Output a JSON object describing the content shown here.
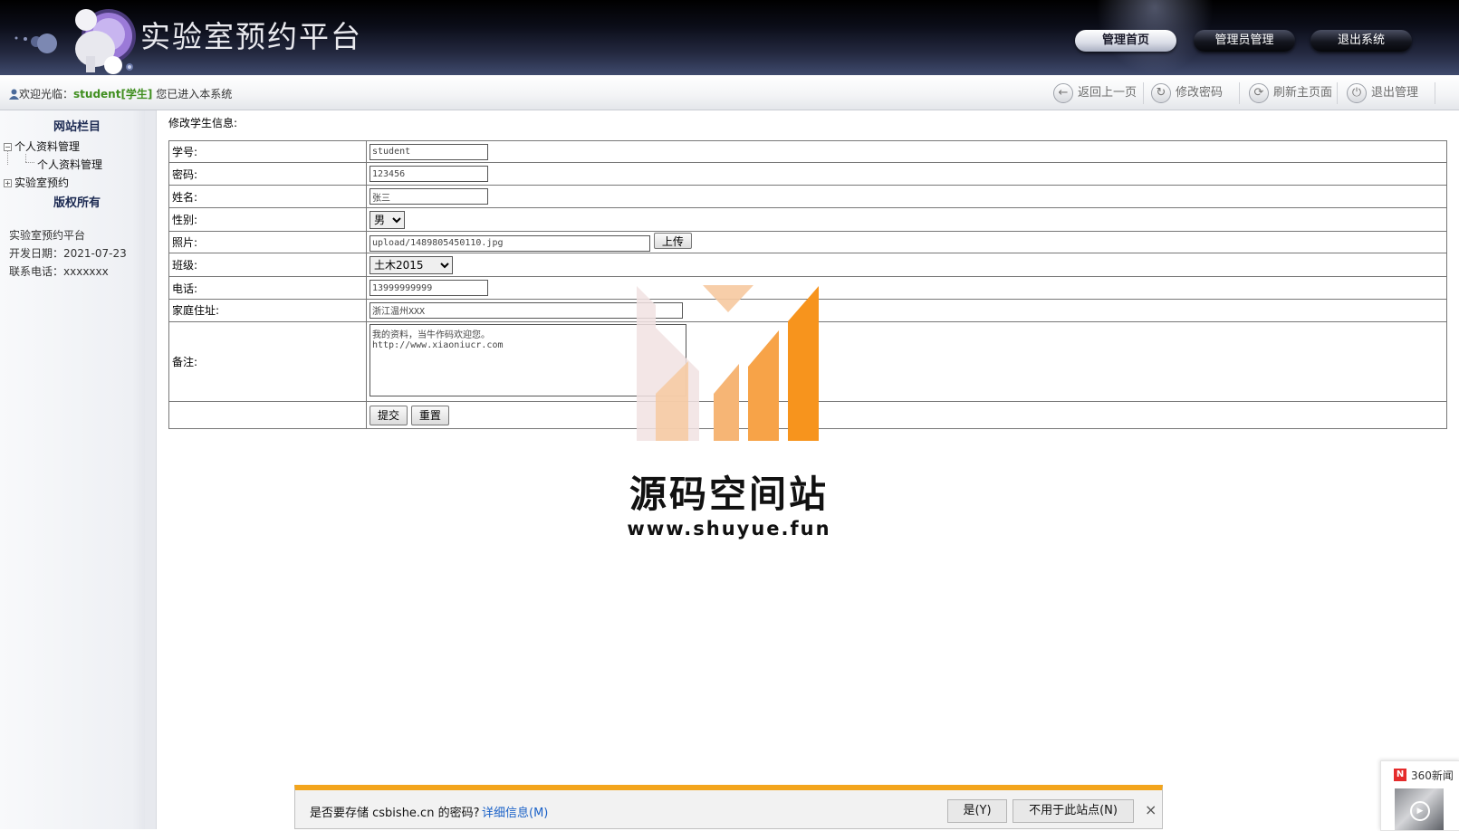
{
  "header": {
    "title": "实验室预约平台",
    "nav": [
      {
        "label": "管理首页",
        "active": true
      },
      {
        "label": "管理员管理",
        "active": false
      },
      {
        "label": "退出系统",
        "active": false
      }
    ]
  },
  "welcome": {
    "prefix": "欢迎光临：",
    "user": "student[学生]",
    "suffix": " 您已进入本系统"
  },
  "toolbar": {
    "back": "返回上一页",
    "change_password": "修改密码",
    "refresh": "刷新主页面",
    "logout": "退出管理"
  },
  "sidebar": {
    "heading": "网站栏目",
    "tree": [
      {
        "label": "个人资料管理",
        "expanded": true,
        "children": [
          "个人资料管理"
        ]
      },
      {
        "label": "实验室预约",
        "expanded": false,
        "children": []
      }
    ],
    "copyright_heading": "版权所有",
    "info": {
      "name": "实验室预约平台",
      "date_label": "开发日期：",
      "date_value": "2021-07-23",
      "phone_label": "联系电话：",
      "phone_value": "xxxxxxx"
    }
  },
  "form": {
    "title": "修改学生信息:",
    "fields": {
      "student_id": {
        "label": "学号:",
        "value": "student"
      },
      "password": {
        "label": "密码:",
        "value": "123456"
      },
      "name": {
        "label": "姓名:",
        "value": "张三"
      },
      "gender": {
        "label": "性别:",
        "value": "男"
      },
      "photo": {
        "label": "照片:",
        "value": "upload/1489805450110.jpg",
        "upload_button": "上传"
      },
      "class": {
        "label": "班级:",
        "value": "土木2015"
      },
      "phone": {
        "label": "电话:",
        "value": "13999999999"
      },
      "address": {
        "label": "家庭住址:",
        "value": "浙江温州XXX"
      },
      "remark": {
        "label": "备注:",
        "value": "我的资料，当牛作码欢迎您。\nhttp://www.xiaoniucr.com"
      }
    },
    "submit": "提交",
    "reset": "重置"
  },
  "watermark": {
    "title": "源码空间站",
    "url": "www.shuyue.fun",
    "colors": {
      "light": "#f1e2e2",
      "mid": "#f6c9a0",
      "orange": "#f7941d"
    }
  },
  "password_bar": {
    "prompt": "是否要存储 csbishe.cn 的密码?",
    "details": "详细信息(M)",
    "yes": "是(Y)",
    "never": "不用于此站点(N)",
    "close": "×",
    "accent": "#f3a51c"
  },
  "news": {
    "logo": "N",
    "label": "360新闻"
  }
}
